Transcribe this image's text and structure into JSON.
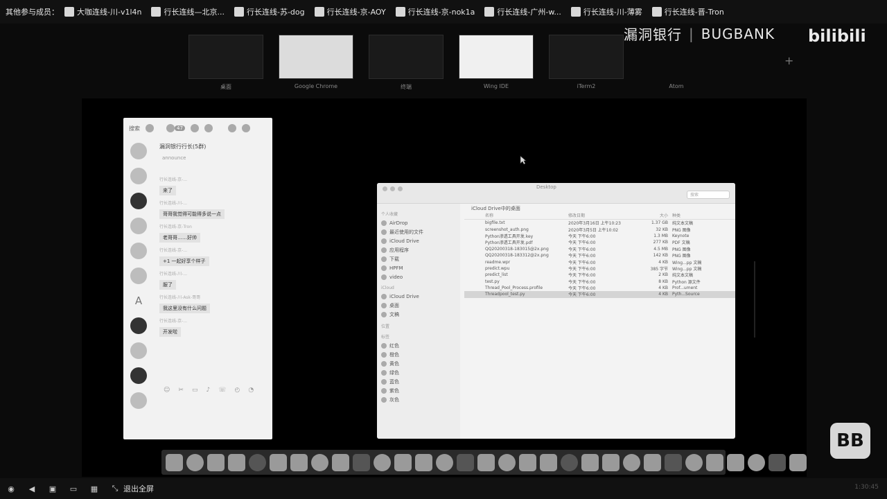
{
  "participants_bar": {
    "label": "其他参与成员：",
    "members": [
      {
        "name": "大咖连线-川-v1l4n"
      },
      {
        "name": "行长连线—北京..."
      },
      {
        "name": "行长连线-苏-dog"
      },
      {
        "name": "行长连线-京-AOY"
      },
      {
        "name": "行长连线-京-nok1a"
      },
      {
        "name": "行长连线-广州-w..."
      },
      {
        "name": "行长连线-川-薄雾"
      },
      {
        "name": "行长连线-晋-Tron"
      }
    ]
  },
  "app_switcher": [
    {
      "label": "桌面",
      "style": "dark"
    },
    {
      "label": "Google Chrome",
      "style": "light"
    },
    {
      "label": "终端",
      "style": "dark"
    },
    {
      "label": "Wing IDE",
      "style": "white"
    },
    {
      "label": "iTerm2",
      "style": "dark"
    },
    {
      "label": "Atom",
      "style": "none"
    }
  ],
  "watermark": {
    "part1": "漏洞银行",
    "separator": "|",
    "part2": "BUGBANK"
  },
  "bilibili": {
    "text": "bilibili"
  },
  "chat_window": {
    "search_placeholder": "搜索",
    "unread_badge": "47",
    "group_title": "漏洞银行行长(5群)",
    "group_subtitle": "announce",
    "messages": [
      {
        "who": "行长连线-京-...",
        "text": "来了"
      },
      {
        "who": "行长连线-川-...",
        "text": "哥哥我觉得可能得多说一点"
      },
      {
        "who": "行长连线-京-Tron",
        "text": "老哥哥……好帅"
      },
      {
        "who": "行长连线-京-...",
        "text": "+1 一起好享个样子"
      },
      {
        "who": "行长连线-川-...",
        "text": "服了"
      },
      {
        "who": "行长连线-川-Ask-哥哥",
        "text": "我这里没有什么问题"
      },
      {
        "who": "行长连线-京-...",
        "text": "开发啦"
      }
    ],
    "tool_icons": [
      "☺",
      "✂",
      "▭",
      "♪",
      "☏",
      "◴",
      "◔"
    ]
  },
  "finder": {
    "window_title": "Desktop",
    "path_label": "iCloud Drive中的桌面",
    "search_placeholder": "搜索",
    "sidebar_groups": [
      {
        "title": "个人收藏",
        "items": [
          "AirDrop",
          "最近使用的文件",
          "iCloud Drive",
          "应用程序",
          "下载",
          "HPFM",
          "video"
        ]
      },
      {
        "title": "iCloud",
        "items": [
          "iCloud Drive",
          "桌面",
          "文稿"
        ]
      },
      {
        "title": "位置",
        "items": []
      },
      {
        "title": "标签",
        "items": [
          "红色",
          "橙色",
          "黄色",
          "绿色",
          "蓝色",
          "紫色",
          "灰色"
        ]
      }
    ],
    "columns": {
      "name": "名称",
      "date": "修改日期",
      "size": "大小",
      "kind": "种类"
    },
    "rows": [
      {
        "name": "bigfile.txt",
        "date": "2020年3月16日 上午10:23",
        "size": "1.37 GB",
        "kind": "纯文本文稿",
        "selected": false
      },
      {
        "name": "screenshot_auth.png",
        "date": "2020年3月5日 上午10:02",
        "size": "32 KB",
        "kind": "PNG 图像",
        "selected": false
      },
      {
        "name": "Python渗透工具开发.key",
        "date": "今天 下午6:00",
        "size": "1.3 MB",
        "kind": "Keynote",
        "selected": false
      },
      {
        "name": "Python渗透工具开发.pdf",
        "date": "今天 下午6:00",
        "size": "277 KB",
        "kind": "PDF 文稿",
        "selected": false
      },
      {
        "name": "QQ20200318-183015@2x.png",
        "date": "今天 下午6:00",
        "size": "4.5 MB",
        "kind": "PNG 图像",
        "selected": false
      },
      {
        "name": "QQ20200318-183312@2x.png",
        "date": "今天 下午6:00",
        "size": "142 KB",
        "kind": "PNG 图像",
        "selected": false
      },
      {
        "name": "readme.wpr",
        "date": "今天 下午6:00",
        "size": "4 KB",
        "kind": "Wing...pp 文稿",
        "selected": false
      },
      {
        "name": "predict.wpu",
        "date": "今天 下午6:00",
        "size": "385 字节",
        "kind": "Wing...pp 文稿",
        "selected": false
      },
      {
        "name": "predict_list",
        "date": "今天 下午6:00",
        "size": "2 KB",
        "kind": "纯文本文稿",
        "selected": false
      },
      {
        "name": "test.py",
        "date": "今天 下午6:00",
        "size": "8 KB",
        "kind": "Python 源文件",
        "selected": false
      },
      {
        "name": "Thread_Pool_Process.profile",
        "date": "今天 下午6:00",
        "size": "4 KB",
        "kind": "Prof...ument",
        "selected": false
      },
      {
        "name": "Threadpool_test.py",
        "date": "今天 下午6:00",
        "size": "4 KB",
        "kind": "Pyth...Source",
        "selected": true
      }
    ]
  },
  "dock": {
    "icon_count": 31
  },
  "side_logo": {
    "text": "BB"
  },
  "bottom_bar": {
    "exit_fullscreen": "退出全屏",
    "time": "1:30:45"
  }
}
